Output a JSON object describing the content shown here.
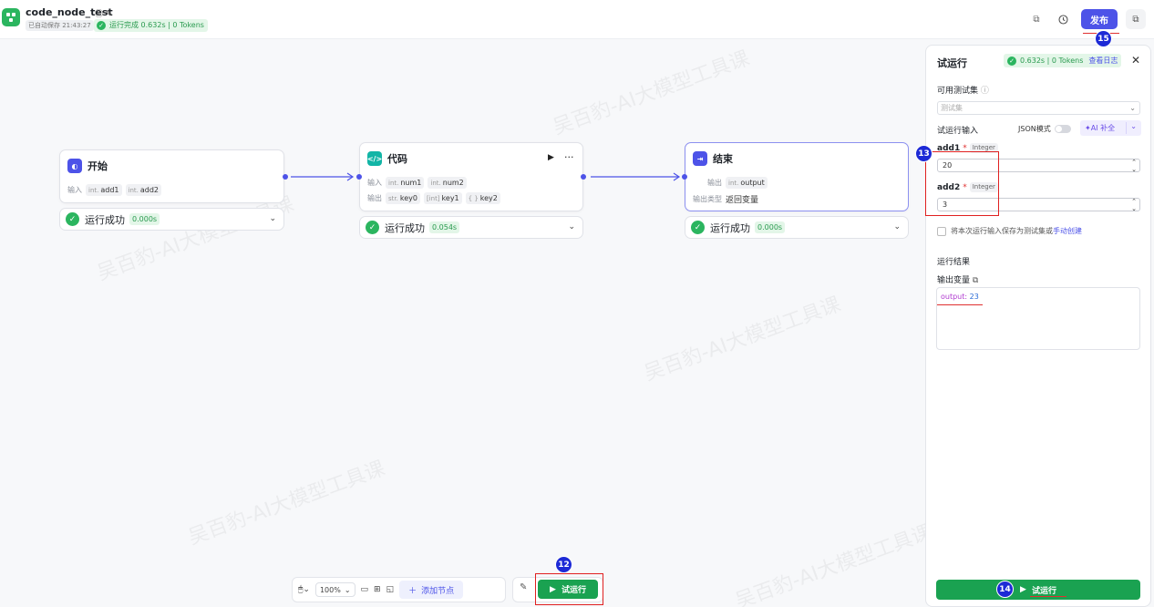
{
  "header": {
    "title": "code_node_test",
    "autosave": "已自动保存 21:43:27",
    "run_status": "运行完成 0.632s | 0 Tokens",
    "publish_label": "发布"
  },
  "markers": {
    "m12": "12",
    "m13": "13",
    "m14": "14",
    "m15": "15"
  },
  "watermark": "吴百豹-AI大模型工具课",
  "nodes": {
    "start": {
      "title": "开始",
      "input_label": "输入",
      "inputs": [
        {
          "type": "int.",
          "name": "add1"
        },
        {
          "type": "int.",
          "name": "add2"
        }
      ],
      "status": "运行成功",
      "time": "0.000s"
    },
    "code": {
      "title": "代码",
      "input_label": "输入",
      "inputs": [
        {
          "type": "int.",
          "name": "num1"
        },
        {
          "type": "int.",
          "name": "num2"
        }
      ],
      "output_label": "输出",
      "outputs": [
        {
          "type": "str.",
          "name": "key0"
        },
        {
          "type": "[int]",
          "name": "key1"
        },
        {
          "type": "{ }",
          "name": "key2"
        }
      ],
      "status": "运行成功",
      "time": "0.054s"
    },
    "end": {
      "title": "结束",
      "output_label": "输出",
      "outputs": [
        {
          "type": "int.",
          "name": "output"
        }
      ],
      "output_type_label": "输出类型",
      "output_type_value": "返回变量",
      "status": "运行成功",
      "time": "0.000s"
    }
  },
  "toolbar": {
    "zoom": "100%",
    "add_node_label": "添加节点",
    "run_label": "试运行"
  },
  "panel": {
    "title": "试运行",
    "status": "0.632s | 0 Tokens",
    "view_log": "查看日志",
    "test_set_label": "可用测试集",
    "test_set_placeholder": "测试集",
    "run_input_label": "试运行输入",
    "json_mode_label": "JSON模式",
    "ai_fill_label": "AI 补全",
    "fields": [
      {
        "name": "add1",
        "type": "Integer",
        "value": "20"
      },
      {
        "name": "add2",
        "type": "Integer",
        "value": "3"
      }
    ],
    "save_text": "将本次运行输入保存为测试集或",
    "save_link": "手动创建",
    "result_label": "运行结果",
    "output_var_label": "输出变量",
    "result_key": "output",
    "result_value": "23",
    "run_button": "试运行"
  }
}
